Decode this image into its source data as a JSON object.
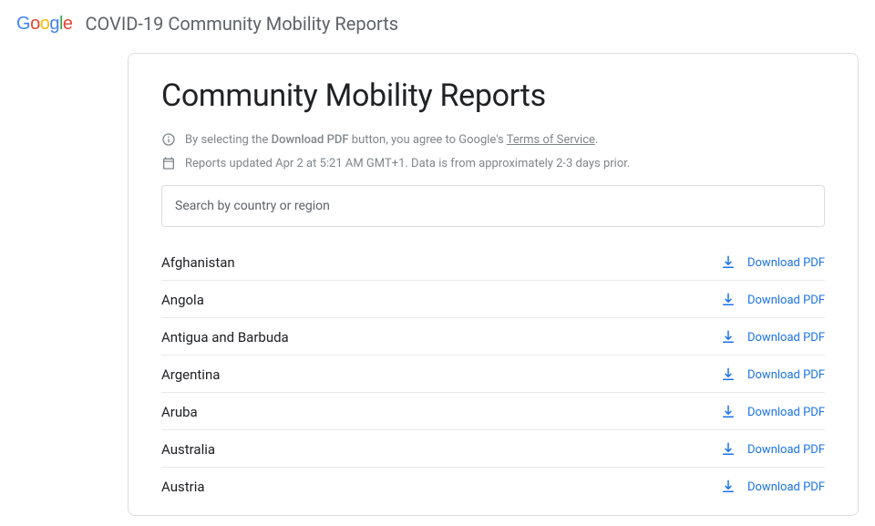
{
  "header": {
    "app_title": "COVID-19 Community Mobility Reports"
  },
  "page": {
    "title": "Community Mobility Reports"
  },
  "disclaimer": {
    "prefix": "By selecting the ",
    "bold": "Download PDF",
    "middle": " button, you agree to Google's ",
    "link": "Terms of Service",
    "suffix": "."
  },
  "updated": {
    "text": "Reports updated Apr 2 at 5:21 AM GMT+1. Data is from approximately 2-3 days prior."
  },
  "search": {
    "placeholder": "Search by country or region"
  },
  "download_label": "Download PDF",
  "countries": [
    {
      "name": "Afghanistan"
    },
    {
      "name": "Angola"
    },
    {
      "name": "Antigua and Barbuda"
    },
    {
      "name": "Argentina"
    },
    {
      "name": "Aruba"
    },
    {
      "name": "Australia"
    },
    {
      "name": "Austria"
    }
  ]
}
